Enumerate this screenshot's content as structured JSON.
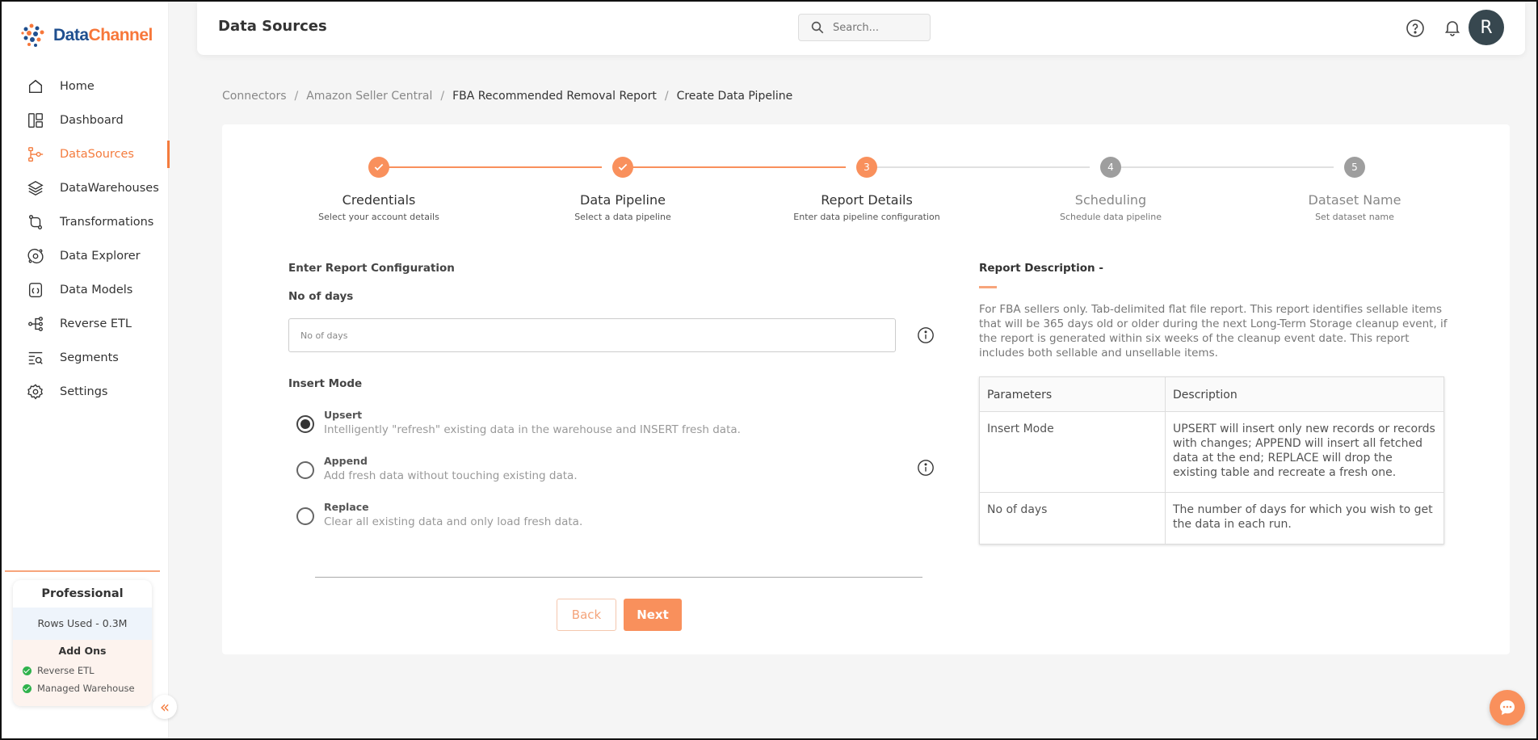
{
  "brand": {
    "name_part1": "Data",
    "name_part2": "Channel"
  },
  "sidebar": {
    "items": [
      {
        "label": "Home",
        "icon": "home-icon",
        "active": false
      },
      {
        "label": "Dashboard",
        "icon": "dashboard-icon",
        "active": false
      },
      {
        "label": "DataSources",
        "icon": "datasources-icon",
        "active": true
      },
      {
        "label": "DataWarehouses",
        "icon": "layers-icon",
        "active": false
      },
      {
        "label": "Transformations",
        "icon": "transformations-icon",
        "active": false
      },
      {
        "label": "Data Explorer",
        "icon": "explorer-icon",
        "active": false
      },
      {
        "label": "Data Models",
        "icon": "models-icon",
        "active": false
      },
      {
        "label": "Reverse ETL",
        "icon": "reverse-etl-icon",
        "active": false
      },
      {
        "label": "Segments",
        "icon": "segments-icon",
        "active": false
      },
      {
        "label": "Settings",
        "icon": "gear-icon",
        "active": false
      }
    ],
    "plan": {
      "name": "Professional",
      "rows_used": "Rows Used - 0.3M",
      "addons_title": "Add Ons",
      "addons": [
        "Reverse ETL",
        "Managed Warehouse"
      ]
    },
    "collapse_glyph": "«"
  },
  "header": {
    "title": "Data Sources",
    "search_placeholder": "Search...",
    "avatar_initial": "R"
  },
  "breadcrumb": {
    "items": [
      "Connectors",
      "Amazon Seller Central",
      "FBA Recommended Removal Report",
      "Create Data Pipeline"
    ],
    "separator": "/"
  },
  "stepper": {
    "steps": [
      {
        "marker": "",
        "title": "Credentials",
        "subtitle": "Select your account details",
        "status": "done"
      },
      {
        "marker": "",
        "title": "Data Pipeline",
        "subtitle": "Select a data pipeline",
        "status": "done"
      },
      {
        "marker": "3",
        "title": "Report Details",
        "subtitle": "Enter data pipeline configuration",
        "status": "current"
      },
      {
        "marker": "4",
        "title": "Scheduling",
        "subtitle": "Schedule data pipeline",
        "status": "todo"
      },
      {
        "marker": "5",
        "title": "Dataset Name",
        "subtitle": "Set dataset name",
        "status": "todo"
      }
    ]
  },
  "form": {
    "heading": "Enter Report Configuration",
    "days_label": "No of days",
    "days_placeholder": "No of days",
    "days_value": "",
    "insert_mode_label": "Insert Mode",
    "modes": [
      {
        "title": "Upsert",
        "description": "Intelligently \"refresh\" existing data in the warehouse and INSERT fresh data.",
        "selected": true
      },
      {
        "title": "Append",
        "description": "Add fresh data without touching existing data.",
        "selected": false
      },
      {
        "title": "Replace",
        "description": "Clear all existing data and only load fresh data.",
        "selected": false
      }
    ],
    "back_label": "Back",
    "next_label": "Next"
  },
  "report": {
    "title": "Report Description -",
    "description": "For FBA sellers only. Tab-delimited flat file report. This report identifies sellable items that will be 365 days old or older during the next Long-Term Storage cleanup event, if the report is generated within six weeks of the cleanup event date. This report includes both sellable and unsellable items.",
    "table_headers": [
      "Parameters",
      "Description"
    ],
    "table_rows": [
      {
        "param": "Insert Mode",
        "desc": "UPSERT will insert only new records or records with changes; APPEND will insert all fetched data at the end; REPLACE will drop the existing table and recreate a fresh one."
      },
      {
        "param": "No of days",
        "desc": "The number of days for which you wish to get the data in each run."
      }
    ]
  },
  "colors": {
    "accent": "#f47b3d",
    "done": "#f9905c",
    "todo": "#9e9e9e",
    "line_todo": "#e0e0e0"
  }
}
